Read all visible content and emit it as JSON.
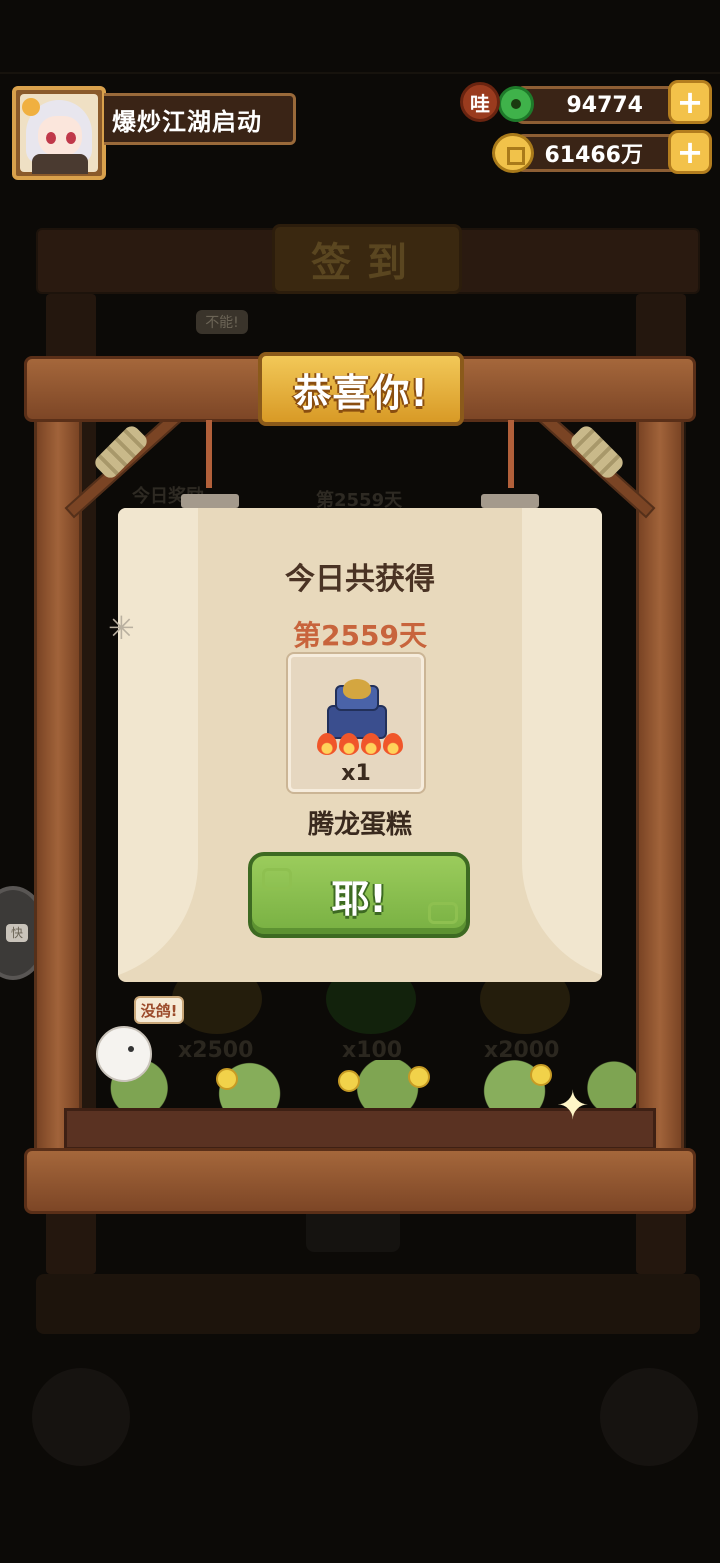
{
  "profile": {
    "name": "爆炒江湖启动"
  },
  "currencies": {
    "jade_badge": "哇",
    "jade": "94774",
    "coins": "61466万",
    "plus_symbol": "+"
  },
  "background": {
    "sign_title": "签到",
    "bubble_text": "不能!",
    "reward_label": "今日奖励",
    "day_label": "第2559天",
    "amounts": [
      "x2500",
      "x100",
      "x2000"
    ],
    "side_pill_text": "快"
  },
  "popup": {
    "banner": "恭喜你!",
    "title": "今日共获得",
    "day": "第2559天",
    "reward": {
      "name": "腾龙蛋糕",
      "quantity": "x1",
      "icon": "dragon-cake-icon"
    },
    "confirm_label": "耶!"
  },
  "mascot": {
    "bubble": "没鸽!"
  },
  "colors": {
    "banner_gold": "#f2c858",
    "button_green": "#8cc052",
    "day_orange": "#c8643c",
    "panel_bg": "#e8d9bc",
    "wood": "#a5673b"
  }
}
